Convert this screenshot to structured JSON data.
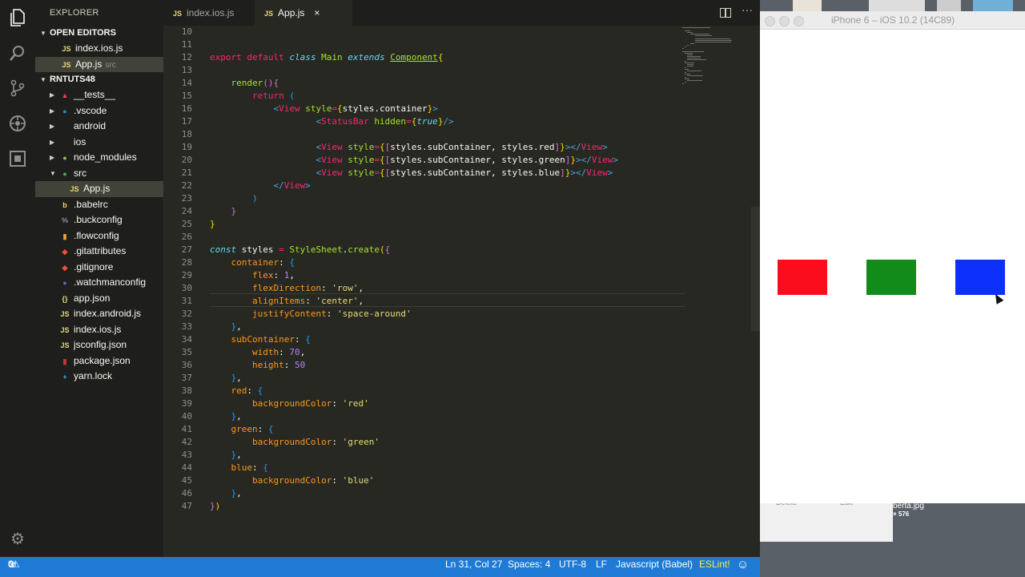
{
  "activity_bar": {
    "icons": [
      "files-icon",
      "search-icon",
      "source-control-icon",
      "debug-icon",
      "extensions-icon",
      "gear-icon"
    ]
  },
  "sidebar": {
    "title": "EXPLORER",
    "open_editors_label": "OPEN EDITORS",
    "open_editors": [
      {
        "icon": "JS",
        "name": "index.ios.js",
        "desc": ""
      },
      {
        "icon": "JS",
        "name": "App.js",
        "desc": "src"
      }
    ],
    "project_label": "RNTUTS48",
    "tree": [
      {
        "name": "__tests__",
        "icon": "▲",
        "color": "#e44",
        "folder": true,
        "expanded": false,
        "indent": 0
      },
      {
        "name": ".vscode",
        "icon": "●",
        "color": "#1f8ad2",
        "folder": true,
        "expanded": false,
        "indent": 0
      },
      {
        "name": "android",
        "icon": "",
        "color": "#cfcfc2",
        "folder": true,
        "expanded": false,
        "indent": 0
      },
      {
        "name": "ios",
        "icon": "",
        "color": "#cfcfc2",
        "folder": true,
        "expanded": false,
        "indent": 0
      },
      {
        "name": "node_modules",
        "icon": "●",
        "color": "#8bc34a",
        "folder": true,
        "expanded": false,
        "indent": 0
      },
      {
        "name": "src",
        "icon": "●",
        "color": "#4caf50",
        "folder": true,
        "expanded": true,
        "indent": 0
      },
      {
        "name": "App.js",
        "icon": "JS",
        "color": "#e6db74",
        "folder": false,
        "indent": 1
      },
      {
        "name": ".babelrc",
        "icon": "b",
        "color": "#f5da55",
        "folder": false,
        "indent": 0
      },
      {
        "name": ".buckconfig",
        "icon": "%",
        "color": "#7f8fa6",
        "folder": false,
        "indent": 0
      },
      {
        "name": ".flowconfig",
        "icon": "▮",
        "color": "#e8a33d",
        "folder": false,
        "indent": 0
      },
      {
        "name": ".gitattributes",
        "icon": "◆",
        "color": "#f05033",
        "folder": false,
        "indent": 0
      },
      {
        "name": ".gitignore",
        "icon": "◆",
        "color": "#f05033",
        "folder": false,
        "indent": 0
      },
      {
        "name": ".watchmanconfig",
        "icon": "●",
        "color": "#5c6bc0",
        "folder": false,
        "indent": 0
      },
      {
        "name": "app.json",
        "icon": "{}",
        "color": "#e6db74",
        "folder": false,
        "indent": 0
      },
      {
        "name": "index.android.js",
        "icon": "JS",
        "color": "#e6db74",
        "folder": false,
        "indent": 0
      },
      {
        "name": "index.ios.js",
        "icon": "JS",
        "color": "#e6db74",
        "folder": false,
        "indent": 0
      },
      {
        "name": "jsconfig.json",
        "icon": "JS",
        "color": "#e6db74",
        "folder": false,
        "indent": 0
      },
      {
        "name": "package.json",
        "icon": "▮",
        "color": "#cb3837",
        "folder": false,
        "indent": 0
      },
      {
        "name": "yarn.lock",
        "icon": "♦",
        "color": "#2c8ebb",
        "folder": false,
        "indent": 0
      }
    ]
  },
  "tabs": [
    {
      "name": "index.ios.js",
      "active": false
    },
    {
      "name": "App.js",
      "active": true,
      "close": "×"
    }
  ],
  "editor": {
    "first_line": 10,
    "lines": [
      [],
      [],
      [
        [
          "kw2",
          "export "
        ],
        [
          "kw2",
          "default "
        ],
        [
          "kw",
          "class "
        ],
        [
          "cls",
          "Main "
        ],
        [
          "kw",
          "extends "
        ],
        [
          "inh",
          "Component"
        ],
        [
          "br1",
          "{"
        ]
      ],
      [],
      [
        [
          "t",
          "    "
        ],
        [
          "fn",
          "render"
        ],
        [
          "br2",
          "()"
        ],
        [
          "br2",
          "{"
        ]
      ],
      [
        [
          "t",
          "        "
        ],
        [
          "kw2",
          "return "
        ],
        [
          "br3",
          "("
        ]
      ],
      [
        [
          "t",
          "            "
        ],
        [
          "tagc",
          "<"
        ],
        [
          "tag",
          "View "
        ],
        [
          "attr",
          "style"
        ],
        [
          "kw2",
          "="
        ],
        [
          "br1",
          "{"
        ],
        [
          "t",
          "styles.container"
        ],
        [
          "br1",
          "}"
        ],
        [
          "tagc",
          ">"
        ]
      ],
      [
        [
          "t",
          "                    "
        ],
        [
          "tagc",
          "<"
        ],
        [
          "tag",
          "StatusBar "
        ],
        [
          "attr",
          "hidden"
        ],
        [
          "kw2",
          "="
        ],
        [
          "br1",
          "{"
        ],
        [
          "kw",
          "true"
        ],
        [
          "br1",
          "}"
        ],
        [
          "tagc",
          "/>"
        ]
      ],
      [],
      [
        [
          "t",
          "                    "
        ],
        [
          "tagc",
          "<"
        ],
        [
          "tag",
          "View "
        ],
        [
          "attr",
          "style"
        ],
        [
          "kw2",
          "="
        ],
        [
          "br1",
          "{"
        ],
        [
          "br2",
          "["
        ],
        [
          "t",
          "styles.subContainer, styles.red"
        ],
        [
          "br2",
          "]"
        ],
        [
          "br1",
          "}"
        ],
        [
          "tagc",
          "></"
        ],
        [
          "tag",
          "View"
        ],
        [
          "tagc",
          ">"
        ]
      ],
      [
        [
          "t",
          "                    "
        ],
        [
          "tagc",
          "<"
        ],
        [
          "tag",
          "View "
        ],
        [
          "attr",
          "style"
        ],
        [
          "kw2",
          "="
        ],
        [
          "br1",
          "{"
        ],
        [
          "br2",
          "["
        ],
        [
          "t",
          "styles.subContainer, styles.green"
        ],
        [
          "br2",
          "]"
        ],
        [
          "br1",
          "}"
        ],
        [
          "tagc",
          "></"
        ],
        [
          "tag",
          "View"
        ],
        [
          "tagc",
          ">"
        ]
      ],
      [
        [
          "t",
          "                    "
        ],
        [
          "tagc",
          "<"
        ],
        [
          "tag",
          "View "
        ],
        [
          "attr",
          "style"
        ],
        [
          "kw2",
          "="
        ],
        [
          "br1",
          "{"
        ],
        [
          "br2",
          "["
        ],
        [
          "t",
          "styles.subContainer, styles.blue"
        ],
        [
          "br2",
          "]"
        ],
        [
          "br1",
          "}"
        ],
        [
          "tagc",
          "></"
        ],
        [
          "tag",
          "View"
        ],
        [
          "tagc",
          ">"
        ]
      ],
      [
        [
          "t",
          "            "
        ],
        [
          "tagc",
          "</"
        ],
        [
          "tag",
          "View"
        ],
        [
          "tagc",
          ">"
        ]
      ],
      [
        [
          "t",
          "        "
        ],
        [
          "br3",
          ")"
        ]
      ],
      [
        [
          "t",
          "    "
        ],
        [
          "br2",
          "}"
        ]
      ],
      [
        [
          "br1",
          "}"
        ]
      ],
      [],
      [
        [
          "kw",
          "const "
        ],
        [
          "t",
          "styles "
        ],
        [
          "kw2",
          "= "
        ],
        [
          "obj",
          "StyleSheet"
        ],
        [
          "t",
          "."
        ],
        [
          "fn",
          "create"
        ],
        [
          "br1",
          "("
        ],
        [
          "br2",
          "{"
        ]
      ],
      [
        [
          "t",
          "    "
        ],
        [
          "prop",
          "container"
        ],
        [
          "t",
          ": "
        ],
        [
          "br3",
          "{"
        ]
      ],
      [
        [
          "t",
          "        "
        ],
        [
          "prop",
          "flex"
        ],
        [
          "t",
          ": "
        ],
        [
          "num",
          "1"
        ],
        [
          "t",
          ","
        ]
      ],
      [
        [
          "t",
          "        "
        ],
        [
          "prop",
          "flexDirection"
        ],
        [
          "t",
          ": "
        ],
        [
          "str",
          "'row'"
        ],
        [
          "t",
          ","
        ]
      ],
      [
        [
          "t",
          "        "
        ],
        [
          "prop",
          "alignItems"
        ],
        [
          "t",
          ": "
        ],
        [
          "str",
          "'center'"
        ],
        [
          "t",
          ","
        ]
      ],
      [
        [
          "t",
          "        "
        ],
        [
          "prop",
          "justifyContent"
        ],
        [
          "t",
          ": "
        ],
        [
          "str",
          "'space-around'"
        ]
      ],
      [
        [
          "t",
          "    "
        ],
        [
          "br3",
          "}"
        ],
        [
          "t",
          ","
        ]
      ],
      [
        [
          "t",
          "    "
        ],
        [
          "prop",
          "subContainer"
        ],
        [
          "t",
          ": "
        ],
        [
          "br3",
          "{"
        ]
      ],
      [
        [
          "t",
          "        "
        ],
        [
          "prop",
          "width"
        ],
        [
          "t",
          ": "
        ],
        [
          "num",
          "70"
        ],
        [
          "t",
          ","
        ]
      ],
      [
        [
          "t",
          "        "
        ],
        [
          "prop",
          "height"
        ],
        [
          "t",
          ": "
        ],
        [
          "num",
          "50"
        ]
      ],
      [
        [
          "t",
          "    "
        ],
        [
          "br3",
          "}"
        ],
        [
          "t",
          ","
        ]
      ],
      [
        [
          "t",
          "    "
        ],
        [
          "prop",
          "red"
        ],
        [
          "t",
          ": "
        ],
        [
          "br3",
          "{"
        ]
      ],
      [
        [
          "t",
          "        "
        ],
        [
          "prop",
          "backgroundColor"
        ],
        [
          "t",
          ": "
        ],
        [
          "str",
          "'red'"
        ]
      ],
      [
        [
          "t",
          "    "
        ],
        [
          "br3",
          "}"
        ],
        [
          "t",
          ","
        ]
      ],
      [
        [
          "t",
          "    "
        ],
        [
          "prop",
          "green"
        ],
        [
          "t",
          ": "
        ],
        [
          "br3",
          "{"
        ]
      ],
      [
        [
          "t",
          "        "
        ],
        [
          "prop",
          "backgroundColor"
        ],
        [
          "t",
          ": "
        ],
        [
          "str",
          "'green'"
        ]
      ],
      [
        [
          "t",
          "    "
        ],
        [
          "br3",
          "}"
        ],
        [
          "t",
          ","
        ]
      ],
      [
        [
          "t",
          "    "
        ],
        [
          "prop",
          "blue"
        ],
        [
          "t",
          ": "
        ],
        [
          "br3",
          "{"
        ]
      ],
      [
        [
          "t",
          "        "
        ],
        [
          "prop",
          "backgroundColor"
        ],
        [
          "t",
          ": "
        ],
        [
          "str",
          "'blue'"
        ]
      ],
      [
        [
          "t",
          "    "
        ],
        [
          "br3",
          "}"
        ],
        [
          "t",
          ","
        ]
      ],
      [
        [
          "br2",
          "}"
        ],
        [
          "br1",
          ")"
        ]
      ]
    ]
  },
  "statusbar": {
    "errors": "0",
    "warnings": "0",
    "position": "Ln 31, Col 27",
    "spaces": "Spaces: 4",
    "encoding": "UTF-8",
    "eol": "LF",
    "language": "Javascript (Babel)",
    "linter": "ESLint!",
    "smiley": "☺"
  },
  "simulator": {
    "title": "iPhone 6 – iOS 10.2 (14C89)",
    "boxes": [
      {
        "name": "red-box",
        "color": "#fc0d1b"
      },
      {
        "name": "green-box",
        "color": "#138b1a"
      },
      {
        "name": "blue-box",
        "color": "#0d2ffa"
      }
    ]
  },
  "desktop": {
    "file_label": "berta.jpg",
    "file_size": "× 576",
    "btn1": "Delete",
    "btn2": "Edit"
  }
}
